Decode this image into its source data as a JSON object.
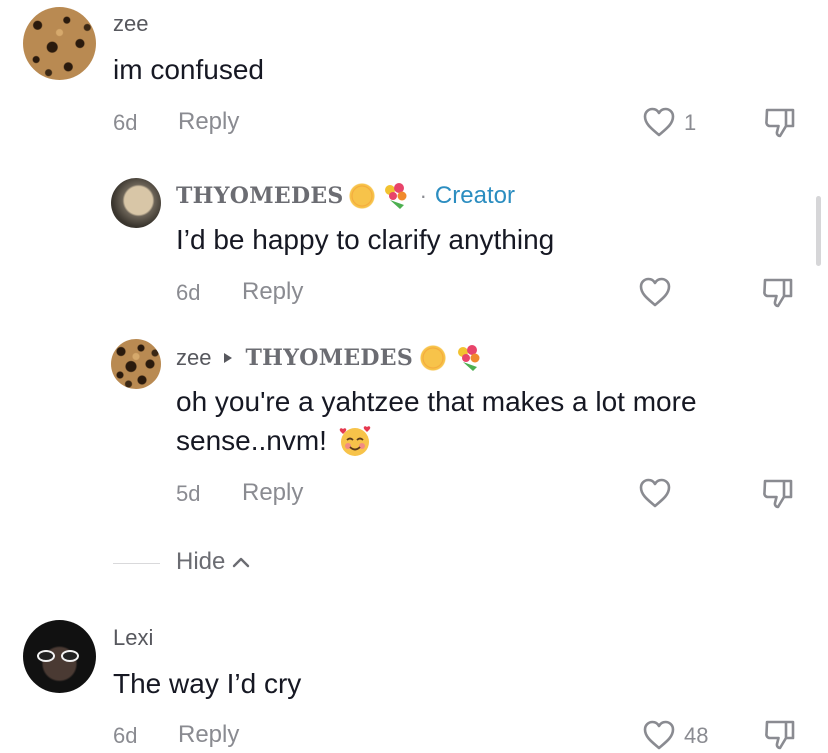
{
  "comments": [
    {
      "username": "zee",
      "text": "im confused",
      "age": "6d",
      "reply_label": "Reply",
      "like_count": "1"
    },
    {
      "username": "THYOMEDES",
      "separator": "·",
      "creator_label": "Creator",
      "text": "I’d be happy to clarify anything",
      "age": "6d",
      "reply_label": "Reply"
    },
    {
      "username": "zee",
      "reply_to": "THYOMEDES",
      "text_line1": "oh you're a yahtzee that makes a lot more",
      "text_line2": "sense..nvm!",
      "age": "5d",
      "reply_label": "Reply"
    },
    {
      "username": "Lexi",
      "text": "The way I’d cry",
      "age": "6d",
      "reply_label": "Reply",
      "like_count": "48"
    }
  ],
  "hide_label": "Hide",
  "icons": {
    "like": "heart-outline-icon",
    "dislike": "thumbs-down-outline-icon",
    "reply_arrow": "play-triangle-icon",
    "collapse": "chevron-up-icon",
    "emoji_1": "sun-face-emoji",
    "emoji_2": "bouquet-emoji",
    "emoji_3": "smiling-face-with-hearts-emoji"
  },
  "colors": {
    "text": "#161823",
    "muted": "#8a8b91",
    "creator": "#2b8dc0"
  }
}
